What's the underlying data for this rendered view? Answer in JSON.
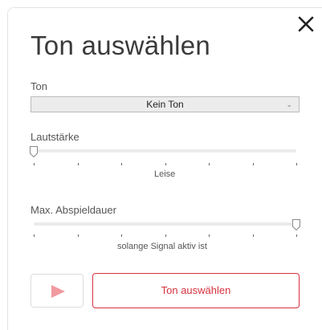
{
  "dialog": {
    "title": "Ton auswählen",
    "close_icon": "close-icon"
  },
  "tone": {
    "label": "Ton",
    "selected": "Kein Ton",
    "chevron": "⌄"
  },
  "volume": {
    "label": "Lautstärke",
    "value_label": "Leise",
    "level": 0
  },
  "duration": {
    "label": "Max. Abspieldauer",
    "value_label": "solange Signal aktiv ist",
    "level": 1
  },
  "actions": {
    "play_icon": "play-icon",
    "select_label": "Ton auswählen"
  },
  "colors": {
    "accent": "#d6323d",
    "play": "#f19aa0"
  }
}
